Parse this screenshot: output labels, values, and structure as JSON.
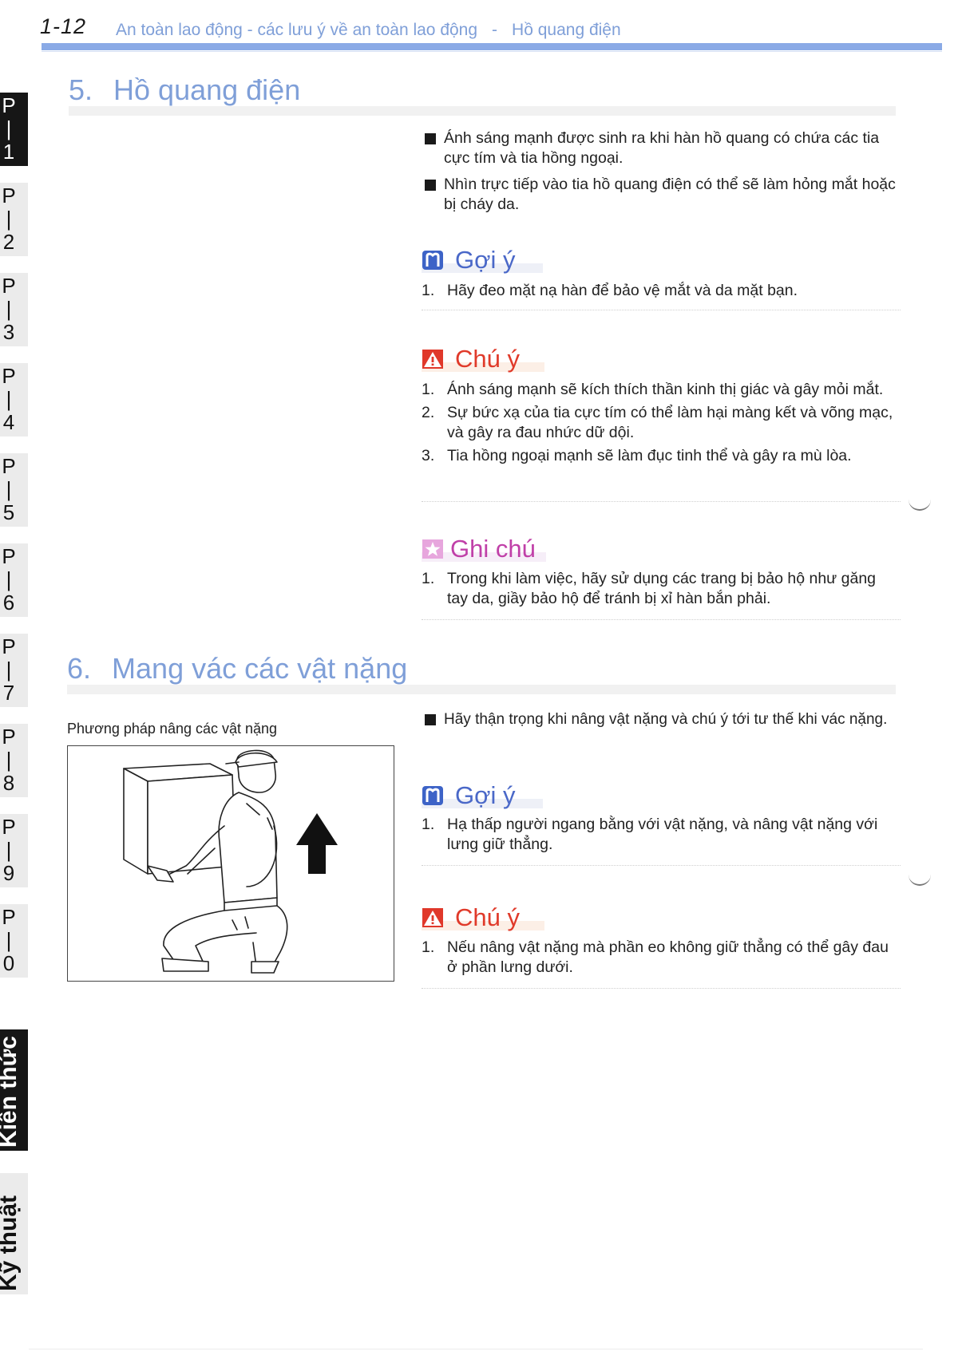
{
  "header": {
    "page_number": "1-12",
    "chapter": "An toàn lao động - các lưu ý về an toàn lao động",
    "separator": "-",
    "section": "Hồ quang điện"
  },
  "side_tabs": [
    {
      "label": "P\n|\n1",
      "active": true
    },
    {
      "label": "P\n|\n2",
      "active": false
    },
    {
      "label": "P\n|\n3",
      "active": false
    },
    {
      "label": "P\n|\n4",
      "active": false
    },
    {
      "label": "P\n|\n5",
      "active": false
    },
    {
      "label": "P\n|\n6",
      "active": false
    },
    {
      "label": "P\n|\n7",
      "active": false
    },
    {
      "label": "P\n|\n8",
      "active": false
    },
    {
      "label": "P\n|\n9",
      "active": false
    },
    {
      "label": "P\n|\n0",
      "active": false
    }
  ],
  "side_vertical": [
    {
      "label": "Kiến thức",
      "active": true
    },
    {
      "label": "Kỹ thuật",
      "active": false
    }
  ],
  "section5": {
    "number": "5.",
    "title": "Hồ quang điện",
    "bullets": [
      "Ánh sáng mạnh được sinh ra khi hàn hồ quang có chứa các tia cực tím và tia hồng ngoại.",
      "Nhìn trực tiếp vào tia hồ quang điện có thể sẽ làm hỏng mắt hoặc bị cháy da."
    ],
    "hint": {
      "label": "Gợi ý",
      "items": [
        "Hãy đeo mặt nạ hàn để bảo vệ mắt và da mặt bạn."
      ]
    },
    "caution": {
      "label": "Chú ý",
      "items": [
        "Ánh sáng mạnh sẽ kích thích thần kinh thị giác và gây mỏi mắt.",
        "Sự bức xạ của tia cực tím có thể làm hại màng kết và võng mạc, và gây ra đau nhức dữ dội.",
        "Tia hồng ngoại mạnh sẽ làm đục tinh thể và gây ra mù lòa."
      ]
    },
    "note": {
      "label": "Ghi chú",
      "items": [
        "Trong khi làm việc, hãy sử dụng các trang bị bảo hộ như găng tay da, giầy bảo hộ để tránh bị xỉ hàn bắn phải."
      ]
    }
  },
  "section6": {
    "number": "6.",
    "title": "Mang vác các vật nặng",
    "figure_caption": "Phương pháp nâng các vật nặng",
    "bullets": [
      "Hãy thận trọng khi nâng vật nặng và chú ý tới tư thế khi vác nặng."
    ],
    "hint": {
      "label": "Gợi ý",
      "items": [
        "Hạ thấp người ngang bằng với vật nặng, và nâng vật nặng với lưng giữ thẳng."
      ]
    },
    "caution": {
      "label": "Chú ý",
      "items": [
        "Nếu nâng vật nặng mà phần eo không giữ thẳng có thể gây đau ở phần lưng dưới."
      ]
    }
  },
  "colors": {
    "heading": "#7f9fd8",
    "header_bar": "#8aaae6",
    "hint": "#4a68c8",
    "caution": "#e03a2a",
    "note": "#c040a8",
    "tab_active": "#161616",
    "tab_inactive": "#ebebeb"
  },
  "icons": {
    "hint": "hint-book-icon",
    "caution": "warning-triangle-icon",
    "note": "star-note-icon",
    "bullet": "square-bullet-icon",
    "figure_arrow": "up-arrow-icon"
  }
}
